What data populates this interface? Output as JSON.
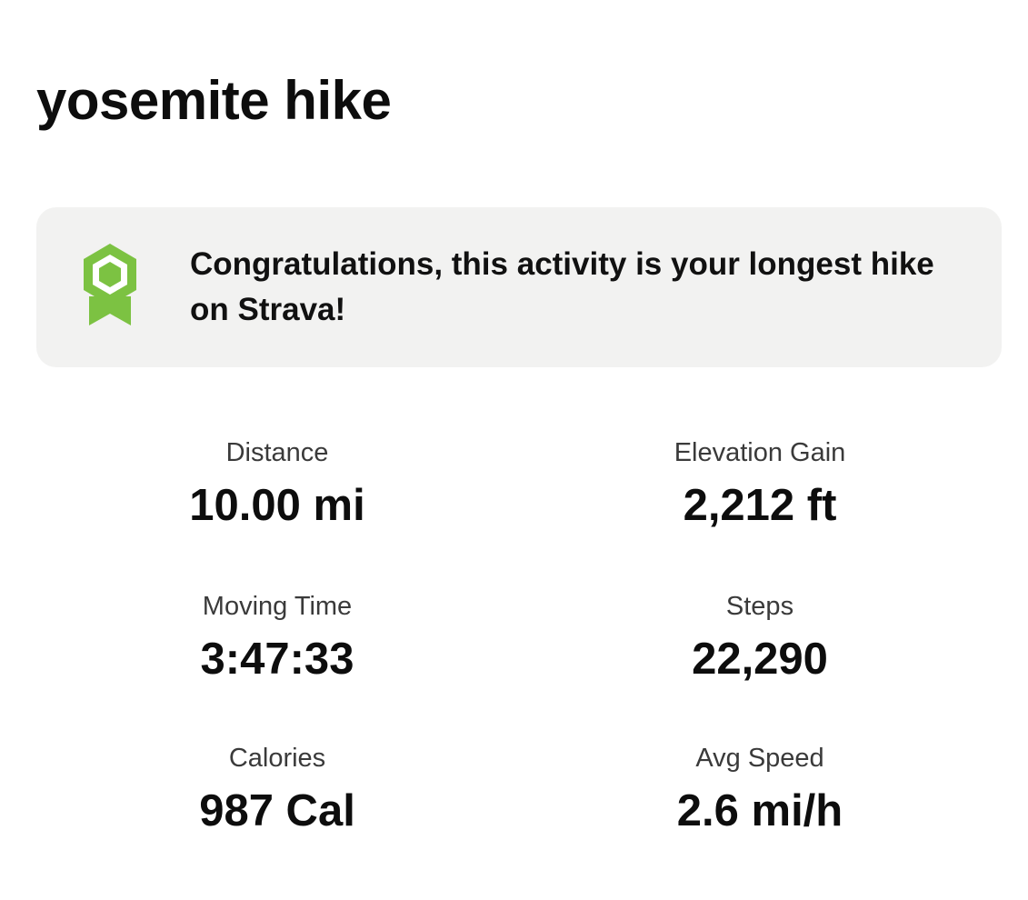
{
  "activity": {
    "title": "yosemite hike"
  },
  "achievement": {
    "icon": "achievement-badge-icon",
    "icon_color": "#7cc242",
    "message": "Congratulations, this activity is your longest hike on Strava!"
  },
  "stats": {
    "distance": {
      "label": "Distance",
      "value": "10.00 mi"
    },
    "elevation_gain": {
      "label": "Elevation Gain",
      "value": "2,212 ft"
    },
    "moving_time": {
      "label": "Moving Time",
      "value": "3:47:33"
    },
    "steps": {
      "label": "Steps",
      "value": "22,290"
    },
    "calories": {
      "label": "Calories",
      "value": "987 Cal"
    },
    "avg_speed": {
      "label": "Avg Speed",
      "value": "2.6 mi/h"
    }
  }
}
